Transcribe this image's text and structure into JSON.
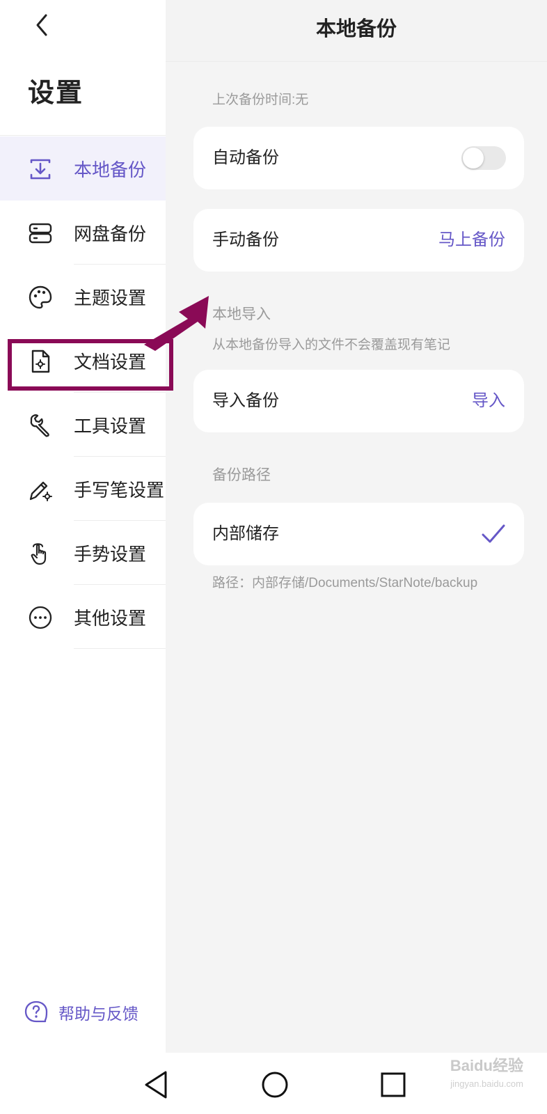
{
  "header": {
    "title": "本地备份"
  },
  "sidebar": {
    "title": "设置",
    "items": [
      {
        "label": "本地备份",
        "icon": "download-box-icon",
        "active": true
      },
      {
        "label": "网盘备份",
        "icon": "server-icon"
      },
      {
        "label": "主题设置",
        "icon": "palette-icon"
      },
      {
        "label": "文档设置",
        "icon": "document-gear-icon"
      },
      {
        "label": "工具设置",
        "icon": "wrench-icon"
      },
      {
        "label": "手写笔设置",
        "icon": "pen-gear-icon"
      },
      {
        "label": "手势设置",
        "icon": "hand-pointer-icon"
      },
      {
        "label": "其他设置",
        "icon": "more-circle-icon"
      }
    ],
    "help": "帮助与反馈"
  },
  "main": {
    "last_backup": "上次备份时间:无",
    "auto_backup": {
      "label": "自动备份",
      "enabled": false
    },
    "manual_backup": {
      "label": "手动备份",
      "action": "马上备份"
    },
    "import_section": {
      "title": "本地导入",
      "note": "从本地备份导入的文件不会覆盖现有笔记",
      "label": "导入备份",
      "action": "导入"
    },
    "path_section": {
      "title": "备份路径",
      "option": "内部储存",
      "selected": true,
      "path": "路径：内部存储/Documents/StarNote/backup"
    }
  },
  "watermark": {
    "text": "Baidu经验",
    "sub": "jingyan.baidu.com"
  },
  "colors": {
    "accent": "#6557c7",
    "annotation": "#8a0a56"
  }
}
